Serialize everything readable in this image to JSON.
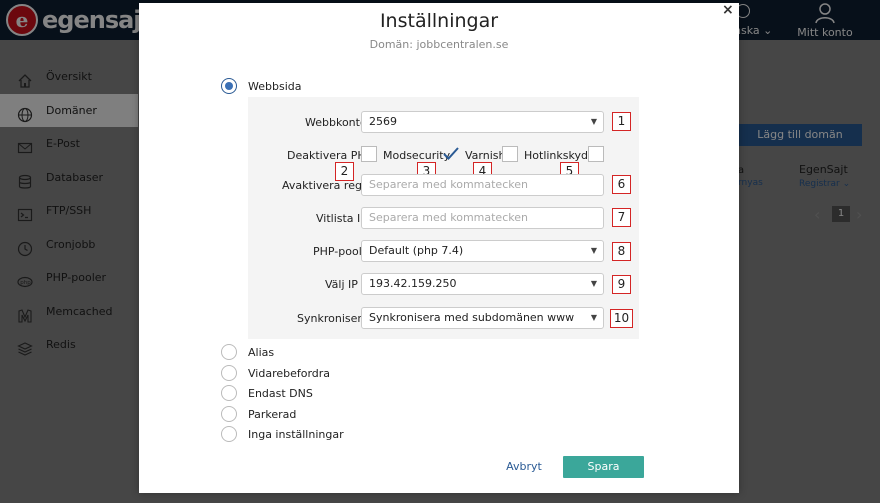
{
  "app": {
    "logo_mark": "e",
    "logo_text": "egensaj",
    "language_label": "nska",
    "account_label": "Mitt konto"
  },
  "sidebar": {
    "items": [
      {
        "label": "Översikt",
        "icon": "home-icon"
      },
      {
        "label": "Domäner",
        "icon": "globe-icon"
      },
      {
        "label": "E-Post",
        "icon": "mail-icon"
      },
      {
        "label": "Databaser",
        "icon": "database-icon"
      },
      {
        "label": "FTP/SSH",
        "icon": "terminal-icon"
      },
      {
        "label": "Cronjobb",
        "icon": "clock-icon"
      },
      {
        "label": "PHP-pooler",
        "icon": "php-icon"
      },
      {
        "label": "Memcached",
        "icon": "memcached-icon"
      },
      {
        "label": "Redis",
        "icon": "redis-icon"
      }
    ]
  },
  "background": {
    "add_domain_button": "Lägg till domän",
    "col1_head": "a",
    "col1_sub": "rnyas",
    "col2_head": "EgenSajt",
    "col2_sub": "Registrar",
    "page_number": "1"
  },
  "modal": {
    "title": "Inställningar",
    "subtitle": "Domän: jobbcentralen.se",
    "close_glyph": "×",
    "options": {
      "webbsida": "Webbsida",
      "alias": "Alias",
      "vidarebefordra": "Vidarebefordra",
      "endast_dns": "Endast DNS",
      "parkerad": "Parkerad",
      "inga": "Inga inställningar"
    },
    "form": {
      "webbkonto_label": "Webbkonto",
      "webbkonto_value": "2569",
      "deaktivera_php_label": "Deaktivera PHP",
      "modsecurity_label": "Modsecurity",
      "varnish_label": "Varnish",
      "hotlinkskydd_label": "Hotlinkskydd",
      "avaktivera_regler_label": "Avaktivera regler",
      "avaktivera_regler_placeholder": "Separera med kommatecken",
      "vitlista_ip_label": "Vitlista IP",
      "vitlista_ip_placeholder": "Separera med kommatecken",
      "php_pool_label": "PHP-pool",
      "php_pool_value": "Default (php 7.4)",
      "valj_ip_label": "Välj IP",
      "valj_ip_value": "193.42.159.250",
      "synkronisera_label": "Synkronisera",
      "synkronisera_value": "Synkronisera med subdomänen www"
    },
    "markers": [
      "1",
      "2",
      "3",
      "4",
      "5",
      "6",
      "7",
      "8",
      "9",
      "10"
    ],
    "cancel_label": "Avbryt",
    "save_label": "Spara"
  },
  "colors": {
    "topbar": "#0f2033",
    "accent_blue": "#2a5a94",
    "save_green": "#3ba79a",
    "marker_red": "#d42525"
  }
}
